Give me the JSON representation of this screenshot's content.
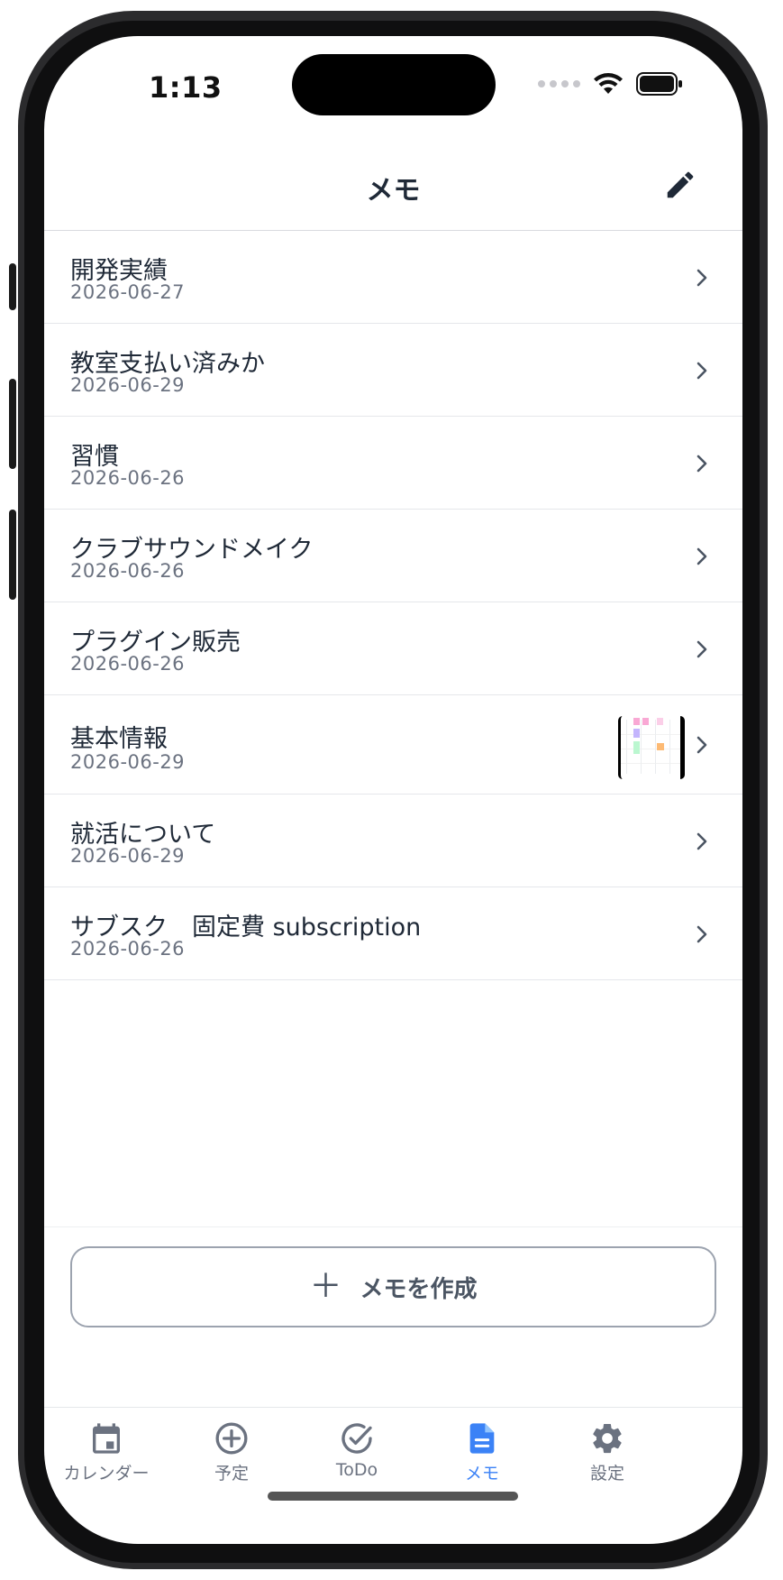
{
  "status_bar": {
    "time": "1:13"
  },
  "nav": {
    "title": "メモ"
  },
  "memos": [
    {
      "title": "開発実績",
      "date": "2026-06-27",
      "has_thumbnail": false
    },
    {
      "title": "教室支払い済みか",
      "date": "2026-06-29",
      "has_thumbnail": false
    },
    {
      "title": "習慣",
      "date": "2026-06-26",
      "has_thumbnail": false
    },
    {
      "title": "クラブサウンドメイク",
      "date": "2026-06-26",
      "has_thumbnail": false
    },
    {
      "title": "プラグイン販売",
      "date": "2026-06-26",
      "has_thumbnail": false
    },
    {
      "title": "基本情報",
      "date": "2026-06-29",
      "has_thumbnail": true
    },
    {
      "title": "就活について",
      "date": "2026-06-29",
      "has_thumbnail": false
    },
    {
      "title": "サブスク　固定費 subscription",
      "date": "2026-06-26",
      "has_thumbnail": false
    }
  ],
  "create_button": {
    "icon": "plus-icon",
    "label": "メモを作成"
  },
  "tabs": [
    {
      "label": "カレンダー",
      "icon": "calendar-icon",
      "active": false
    },
    {
      "label": "予定",
      "icon": "plus-circle-icon",
      "active": false
    },
    {
      "label": "ToDo",
      "icon": "check-circle-icon",
      "active": false
    },
    {
      "label": "メモ",
      "icon": "document-icon",
      "active": true
    },
    {
      "label": "設定",
      "icon": "gear-icon",
      "active": false
    }
  ],
  "colors": {
    "accent": "#3b82f6",
    "text_primary": "#1f2937",
    "text_secondary": "#6b7280",
    "divider": "#e5e7eb",
    "button_border": "#9ca3af"
  }
}
